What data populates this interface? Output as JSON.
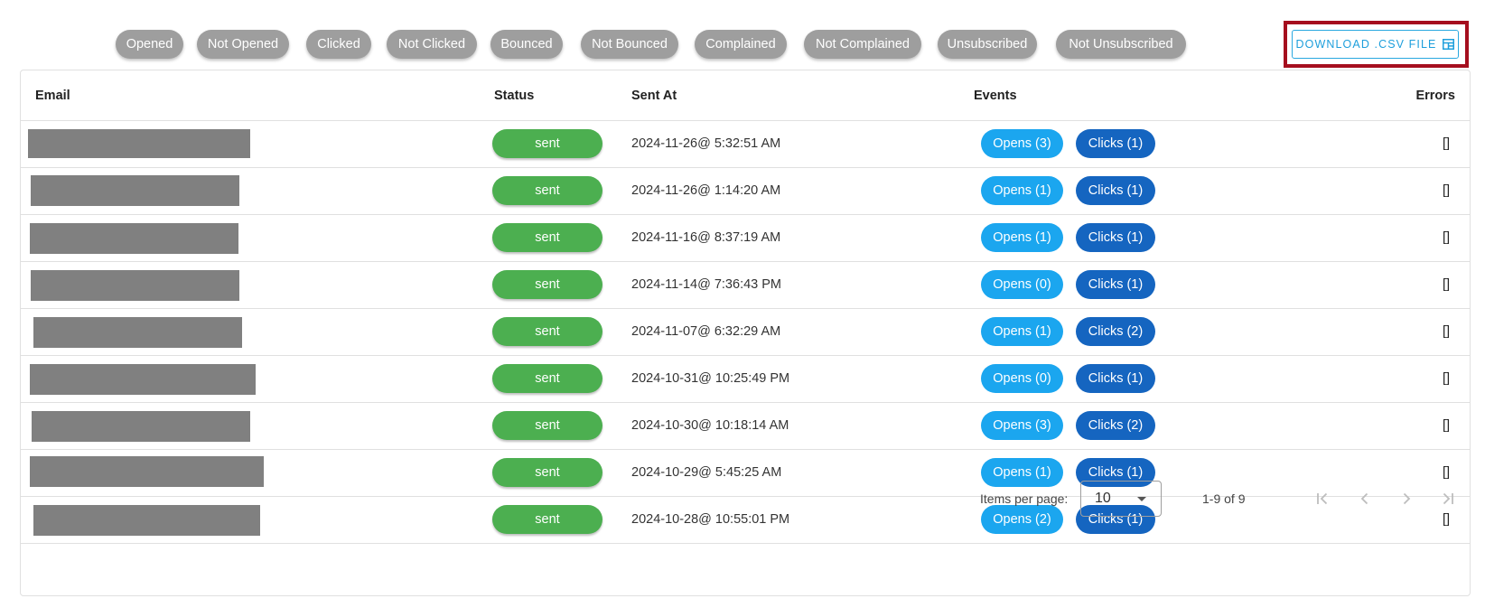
{
  "filters": [
    "Opened",
    "Not Opened",
    "Clicked",
    "Not Clicked",
    "Bounced",
    "Not Bounced",
    "Complained",
    "Not Complained",
    "Unsubscribed",
    "Not Unsubscribed"
  ],
  "download_button": {
    "label": "DOWNLOAD .CSV FILE",
    "icon": "table-icon"
  },
  "table": {
    "headers": {
      "email": "Email",
      "status": "Status",
      "sent_at": "Sent At",
      "events": "Events",
      "errors": "Errors"
    },
    "rows": [
      {
        "email": "",
        "status": "sent",
        "sent_at": "2024-11-26@ 5:32:51 AM",
        "opens": "Opens (3)",
        "clicks": "Clicks (1)",
        "errors": "[]"
      },
      {
        "email": "",
        "status": "sent",
        "sent_at": "2024-11-26@ 1:14:20 AM",
        "opens": "Opens (1)",
        "clicks": "Clicks (1)",
        "errors": "[]"
      },
      {
        "email": "",
        "status": "sent",
        "sent_at": "2024-11-16@ 8:37:19 AM",
        "opens": "Opens (1)",
        "clicks": "Clicks (1)",
        "errors": "[]"
      },
      {
        "email": "",
        "status": "sent",
        "sent_at": "2024-11-14@ 7:36:43 PM",
        "opens": "Opens (0)",
        "clicks": "Clicks (1)",
        "errors": "[]"
      },
      {
        "email": "",
        "status": "sent",
        "sent_at": "2024-11-07@ 6:32:29 AM",
        "opens": "Opens (1)",
        "clicks": "Clicks (2)",
        "errors": "[]"
      },
      {
        "email": "",
        "status": "sent",
        "sent_at": "2024-10-31@ 10:25:49 PM",
        "opens": "Opens (0)",
        "clicks": "Clicks (1)",
        "errors": "[]"
      },
      {
        "email": "",
        "status": "sent",
        "sent_at": "2024-10-30@ 10:18:14 AM",
        "opens": "Opens (3)",
        "clicks": "Clicks (2)",
        "errors": "[]"
      },
      {
        "email": "",
        "status": "sent",
        "sent_at": "2024-10-29@ 5:45:25 AM",
        "opens": "Opens (1)",
        "clicks": "Clicks (1)",
        "errors": "[]"
      },
      {
        "email": "",
        "status": "sent",
        "sent_at": "2024-10-28@ 10:55:01 PM",
        "opens": "Opens (2)",
        "clicks": "Clicks (1)",
        "errors": "[]"
      }
    ]
  },
  "paginator": {
    "items_per_page_label": "Items per page:",
    "items_per_page_value": "10",
    "range_label": "1-9 of 9"
  },
  "colors": {
    "chip": "#9e9e9e",
    "status_sent": "#4caf50",
    "opens": "#1ba6ef",
    "clicks": "#1565c0",
    "download_accent": "#1e9fdc",
    "highlight_outline": "#a50e1e",
    "redacted": "#808080"
  }
}
